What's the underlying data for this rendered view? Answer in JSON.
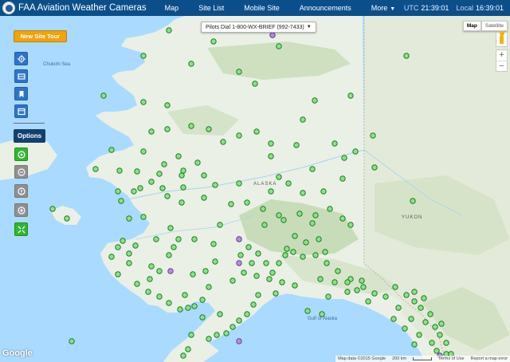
{
  "header": {
    "title": "FAA Aviation Weather Cameras",
    "nav": [
      {
        "label": "Map"
      },
      {
        "label": "Site List"
      },
      {
        "label": "Mobile Site"
      },
      {
        "label": "Announcements"
      },
      {
        "label": "More"
      }
    ],
    "clock": {
      "utc_label": "UTC",
      "utc_time": "21:39:01",
      "local_label": "Local",
      "local_time": "16:39:01"
    }
  },
  "map": {
    "pilot_dropdown": "Pilots Dial 1-800-WX-BRIEF (992-7433)",
    "map_type": [
      "Map",
      "Satellite"
    ],
    "active_map_type": "Map",
    "zoom": [
      "+",
      "−"
    ],
    "labels": {
      "chukchi_sea": "Chukchi Sea",
      "alaska": "ALASKA",
      "yukon": "YUKON",
      "gulf_of_alaska": "Gulf of Alaska"
    },
    "google_logo": "Google",
    "attribution": {
      "map_data": "Map data ©2015 Google",
      "scale": "200 km",
      "terms": "Terms of Use",
      "report": "Report a map error"
    }
  },
  "toolbar": {
    "site_tour_label": "New Site Tour",
    "options_label": "Options",
    "icons": [
      "locate-icon",
      "list-icon",
      "bookmark-icon",
      "calendar-icon",
      "cam-green-icon",
      "cam-gray-icon",
      "help-icon",
      "info-icon",
      "fullscreen-icon"
    ]
  },
  "colors": {
    "nav_bg": "#0b4f8a",
    "tour_btn": "#f0a30a",
    "camera_marker": "#8ee08e",
    "camera_marker_alt": "#b98ee0",
    "water": "#aadaff",
    "land": "#e8eee4"
  }
}
